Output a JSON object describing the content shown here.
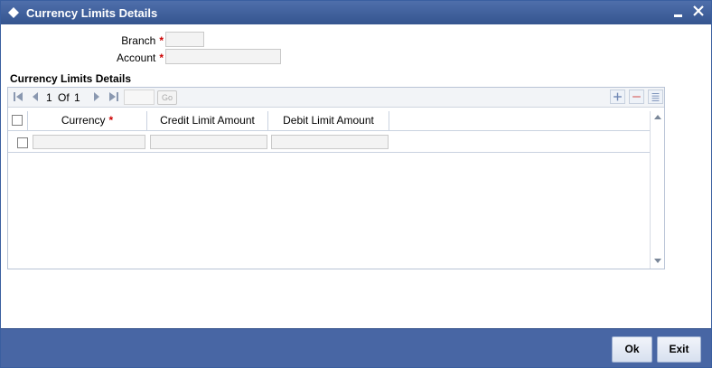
{
  "window": {
    "title": "Currency Limits Details"
  },
  "form": {
    "branch_label": "Branch",
    "account_label": "Account",
    "required_mark": "*",
    "branch_value": "",
    "account_value": ""
  },
  "section": {
    "title": "Currency Limits Details"
  },
  "pager": {
    "current": "1",
    "of_label": "Of",
    "total": "1",
    "go_label": "Go",
    "goto_value": ""
  },
  "grid": {
    "columns": [
      {
        "label": "Currency",
        "required": "*"
      },
      {
        "label": "Credit Limit Amount"
      },
      {
        "label": "Debit Limit Amount"
      }
    ],
    "rows": [
      {
        "currency": "",
        "credit_limit": "",
        "debit_limit": ""
      }
    ]
  },
  "buttons": {
    "ok": "Ok",
    "exit": "Exit"
  },
  "colors": {
    "titlebar": "#3d5c97",
    "footer": "#4866a4",
    "required": "#cc0000"
  }
}
